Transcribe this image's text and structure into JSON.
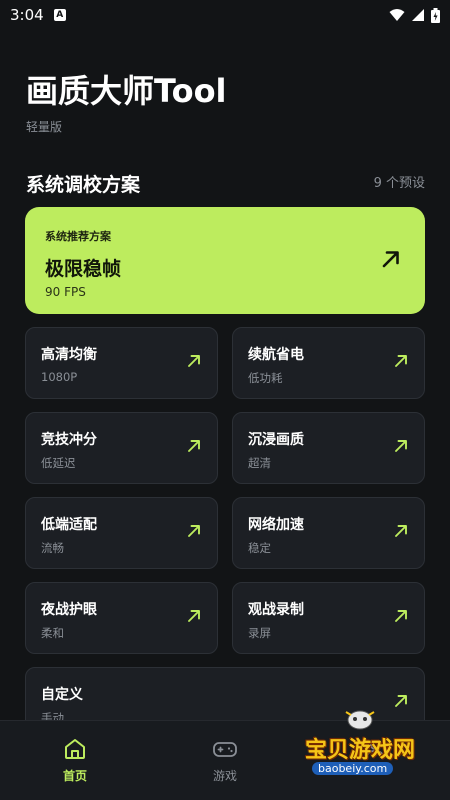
{
  "status_bar": {
    "time": "3:04",
    "notification_icon": "a-badge-icon"
  },
  "header": {
    "title": "画质大师Tool",
    "subtitle": "轻量版"
  },
  "section": {
    "title": "系统调校方案",
    "count": "9 个预设"
  },
  "featured": {
    "tag": "系统推荐方案",
    "name": "极限稳帧",
    "fps": "90 FPS"
  },
  "presets": [
    {
      "title": "高清均衡",
      "sub": "1080P"
    },
    {
      "title": "续航省电",
      "sub": "低功耗"
    },
    {
      "title": "竞技冲分",
      "sub": "低延迟"
    },
    {
      "title": "沉浸画质",
      "sub": "超清"
    },
    {
      "title": "低端适配",
      "sub": "流畅"
    },
    {
      "title": "网络加速",
      "sub": "稳定"
    },
    {
      "title": "夜战护眼",
      "sub": "柔和"
    },
    {
      "title": "观战录制",
      "sub": "录屏"
    },
    {
      "title": "自定义",
      "sub": "手动"
    }
  ],
  "nav": [
    {
      "label": "首页",
      "icon": "home-icon"
    },
    {
      "label": "游戏",
      "icon": "gamepad-icon"
    },
    {
      "label": "",
      "icon": "profile-icon"
    }
  ],
  "watermark": {
    "text": "宝贝游戏网",
    "url": "baobeiy.com"
  },
  "colors": {
    "background": "#121416",
    "accent": "#bdec5e",
    "card": "#1c1f24",
    "muted": "#8a8f96"
  }
}
